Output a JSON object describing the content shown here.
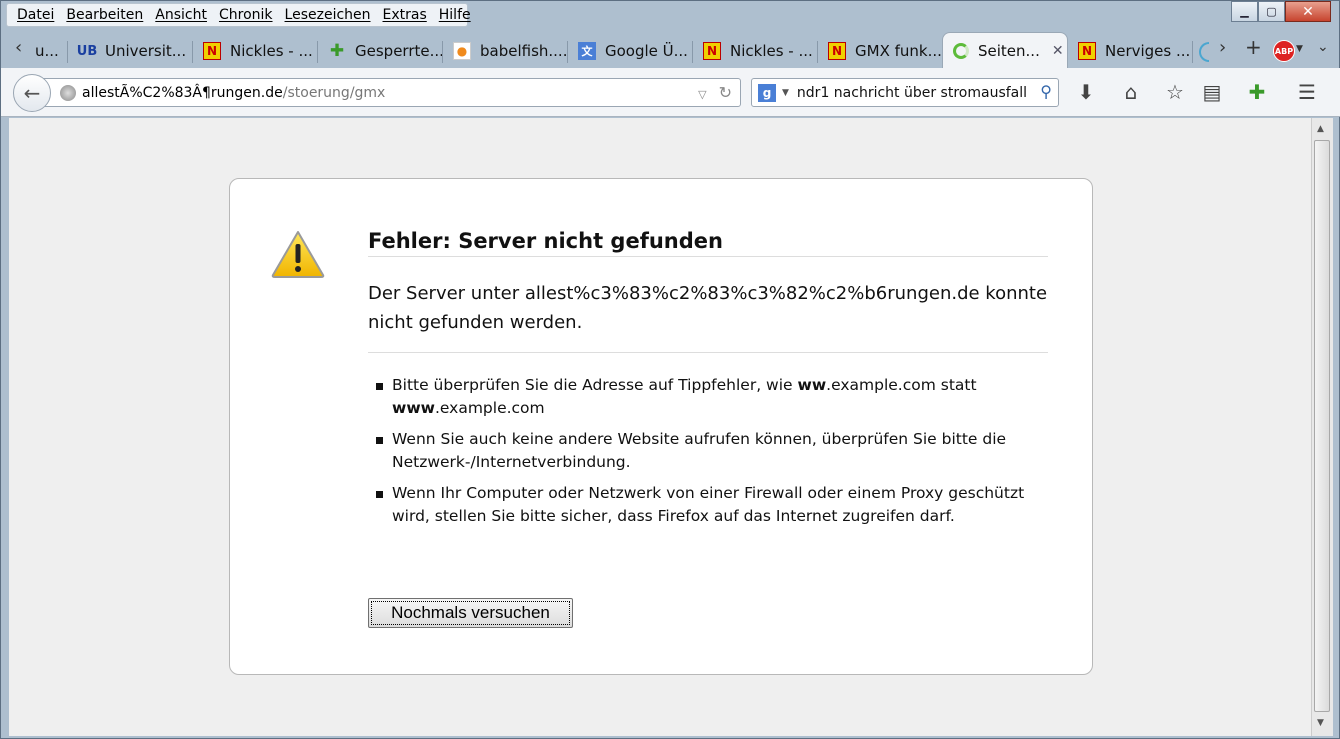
{
  "menu": [
    "Datei",
    "Bearbeiten",
    "Ansicht",
    "Chronik",
    "Lesezeichen",
    "Extras",
    "Hilfe"
  ],
  "tabs": [
    {
      "label": "u...",
      "icon": "partial-tab-icon"
    },
    {
      "label": "Universit...",
      "icon": "ub-icon"
    },
    {
      "label": "Nickles - ...",
      "icon": "nickles-icon"
    },
    {
      "label": "Gesperrte...",
      "icon": "puzzle-icon"
    },
    {
      "label": "babelfish....",
      "icon": "babelfish-icon"
    },
    {
      "label": "Google Ü...",
      "icon": "translate-icon"
    },
    {
      "label": "Nickles - ...",
      "icon": "nickles-icon"
    },
    {
      "label": "GMX funk...",
      "icon": "nickles-icon"
    },
    {
      "label": "Seiten...",
      "icon": "loading-icon",
      "active": true
    },
    {
      "label": "Nerviges ...",
      "icon": "nickles-icon"
    }
  ],
  "url": {
    "host": "allestÃ%C2%83Â¶rungen.de",
    "path": "/stoerung/gmx"
  },
  "search": {
    "engine": "g",
    "value": "ndr1 nachricht über stromausfall"
  },
  "error": {
    "title": "Fehler: Server nicht gefunden",
    "description": "Der Server unter allest%c3%83%c2%83%c3%82%c2%b6rungen.de konnte nicht gefunden werden.",
    "tip1_pre": "Bitte überprüfen Sie die Adresse auf Tippfehler, wie ",
    "tip1_b1": "ww",
    "tip1_mid": ".example.com statt ",
    "tip1_b2": "www",
    "tip1_post": ".example.com",
    "tip2": "Wenn Sie auch keine andere Website aufrufen können, überprüfen Sie bitte die Netzwerk-/Internetverbindung.",
    "tip3": "Wenn Ihr Computer oder Netzwerk von einer Firewall oder einem Proxy geschützt wird, stellen Sie bitte sicher, dass Firefox auf das Internet zugreifen darf.",
    "retry_label": "Nochmals versuchen"
  }
}
